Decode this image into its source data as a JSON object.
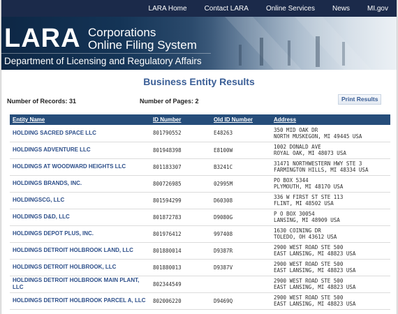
{
  "nav": {
    "items": [
      {
        "label": "LARA Home"
      },
      {
        "label": "Contact LARA"
      },
      {
        "label": "Online Services"
      },
      {
        "label": "News"
      },
      {
        "label": "MI.gov"
      }
    ]
  },
  "banner": {
    "logo": "LARA",
    "title_line1": "Corporations",
    "title_line2": "Online Filing System",
    "department": "Department of Licensing and Regulatory Affairs"
  },
  "page_title": "Business Entity Results",
  "summary": {
    "records_label": "Number of Records: 31",
    "pages_label": "Number of Pages: 2",
    "print_label": "Print Results"
  },
  "table": {
    "headers": [
      "Entity Name",
      "ID Number",
      "Old ID Number",
      "Address"
    ],
    "rows": [
      {
        "name": "HOLDING SACRED SPACE LLC",
        "id": "801790552",
        "old_id": "E48263",
        "addr1": "350 MID OAK DR",
        "addr2": "NORTH MUSKEGON, MI 49445 USA"
      },
      {
        "name": "HOLDINGS ADVENTURE LLC",
        "id": "801948398",
        "old_id": "E8100W",
        "addr1": "1002 DONALD AVE",
        "addr2": "ROYAL OAK, MI 48073 USA"
      },
      {
        "name": "HOLDINGS AT WOODWARD HEIGHTS LLC",
        "id": "801183307",
        "old_id": "B3241C",
        "addr1": "31471 NORTHWESTERN HWY STE 3",
        "addr2": "FARMINGTON HILLS, MI 48334 USA"
      },
      {
        "name": "HOLDINGS BRANDS, INC.",
        "id": "800726985",
        "old_id": "02995M",
        "addr1": "PO BOX 5344",
        "addr2": "PLYMOUTH, MI 48170 USA"
      },
      {
        "name": "HOLDINGSCG, LLC",
        "id": "801594299",
        "old_id": "D60308",
        "addr1": "336 W FIRST ST STE 113",
        "addr2": "FLINT, MI 48502 USA"
      },
      {
        "name": "HOLDINGS D&D, LLC",
        "id": "801872783",
        "old_id": "D9080G",
        "addr1": "P O BOX 30054",
        "addr2": "LANSING, MI 48909 USA"
      },
      {
        "name": "HOLDINGS DEPOT PLUS, INC.",
        "id": "801976412",
        "old_id": "997408",
        "addr1": "1630 COINING DR",
        "addr2": "TOLEDO, OH 43612 USA"
      },
      {
        "name": "HOLDINGS DETROIT HOLBROOK LAND, LLC",
        "id": "801880014",
        "old_id": "D9387R",
        "addr1": "2900 WEST ROAD STE 500",
        "addr2": "EAST LANSING, MI 48823 USA"
      },
      {
        "name": "HOLDINGS DETROIT HOLBROOK, LLC",
        "id": "801880013",
        "old_id": "D9387V",
        "addr1": "2900 WEST ROAD STE 500",
        "addr2": "EAST LANSING, MI 48823 USA"
      },
      {
        "name": "HOLDINGS DETROIT HOLBROOK MAIN PLANT, LLC",
        "id": "802344549",
        "old_id": "",
        "addr1": "2900 WEST ROAD STE 500",
        "addr2": "EAST LANSING, MI 48823 USA"
      },
      {
        "name": "HOLDINGS DETROIT HOLBROOK PARCEL A, LLC",
        "id": "802006220",
        "old_id": "D9469Q",
        "addr1": "2900 WEST ROAD STE 500",
        "addr2": "EAST LANSING, MI 48823 USA"
      }
    ]
  }
}
